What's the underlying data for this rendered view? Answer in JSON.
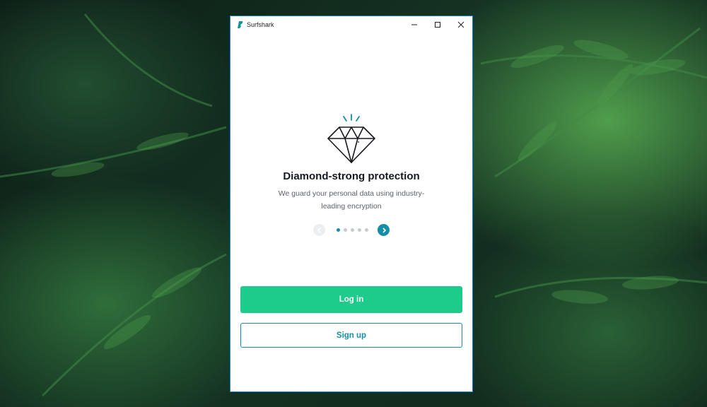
{
  "window": {
    "title": "Surfshark",
    "controls": {
      "minimize_icon": "minimize-icon",
      "maximize_icon": "maximize-icon",
      "close_icon": "close-icon"
    }
  },
  "onboarding": {
    "icon": "diamond-icon",
    "headline": "Diamond-strong protection",
    "description": "We guard your personal data using industry-leading encryption",
    "carousel": {
      "total_slides": 5,
      "active_slide": 1,
      "prev_icon": "chevron-left-icon",
      "next_icon": "chevron-right-icon"
    }
  },
  "actions": {
    "login_label": "Log in",
    "signup_label": "Sign up"
  },
  "colors": {
    "primary_green": "#1dcb8a",
    "accent_teal": "#178ea7",
    "window_border": "#1a86c9"
  }
}
